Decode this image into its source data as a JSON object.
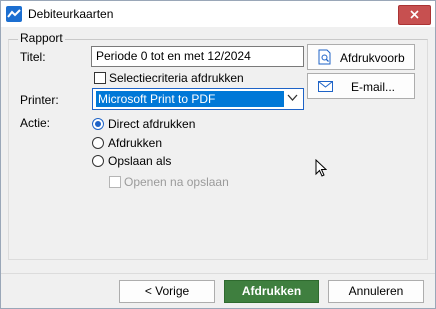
{
  "window": {
    "title": "Debiteurkaarten",
    "close_symbol": "✕"
  },
  "group": {
    "label": "Rapport"
  },
  "form": {
    "title_label": "Titel:",
    "title_value": "Periode 0 tot en met 12/2024",
    "selection_label": "Selectiecriteria afdrukken",
    "printer_label": "Printer:",
    "printer_value": "Microsoft Print to PDF",
    "action_label": "Actie:",
    "actions": [
      {
        "label": "Direct afdrukken",
        "checked": true
      },
      {
        "label": "Afdrukken",
        "checked": false
      },
      {
        "label": "Opslaan als",
        "checked": false
      }
    ],
    "open_after_save_label": "Openen na opslaan"
  },
  "side_buttons": {
    "preview_label": "Afdrukvoorb",
    "email_label": "E-mail..."
  },
  "footer": {
    "prev_label": "< Vorige",
    "print_label": "Afdrukken",
    "cancel_label": "Annuleren"
  },
  "colors": {
    "accent": "#0078d7",
    "primary_button": "#3f7f3f",
    "close_button": "#c75050"
  }
}
